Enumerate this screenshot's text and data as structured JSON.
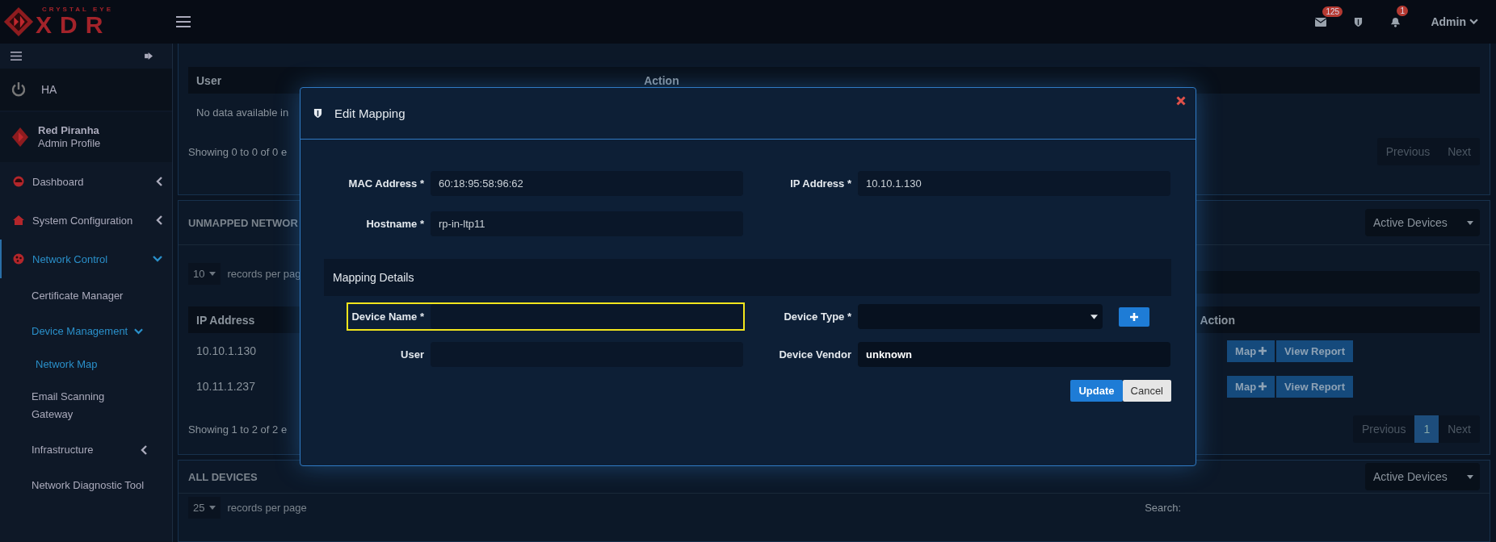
{
  "brand": {
    "tagline": "CRYSTAL EYE",
    "name": "XDR"
  },
  "topbar": {
    "icons": [
      {
        "kind": "mail",
        "badge": "125"
      },
      {
        "kind": "shield"
      },
      {
        "kind": "bell",
        "badge": "1"
      }
    ],
    "user": "Admin"
  },
  "sidebar": {
    "ha": "HA",
    "profile": {
      "name": "Red Piranha",
      "role": "Admin Profile"
    },
    "items": [
      {
        "label": "Dashboard",
        "kind": "gauge",
        "selected": false,
        "expanded": false
      },
      {
        "label": "System Configuration",
        "kind": "home",
        "selected": false,
        "expanded": false
      },
      {
        "label": "Network Control",
        "kind": "globe",
        "selected": true,
        "expanded": true,
        "children": [
          {
            "label": "Certificate Manager",
            "selected": false
          },
          {
            "label": "Device Management",
            "selected": true,
            "expanded": true,
            "children": [
              {
                "label": "Network Map",
                "selected": true
              }
            ]
          },
          {
            "label": "Email Scanning Gateway",
            "selected": false
          },
          {
            "label": "Infrastructure",
            "selected": false,
            "expanded": false
          },
          {
            "label": "Network Diagnostic Tool",
            "selected": false
          }
        ]
      }
    ]
  },
  "panels": [
    {
      "kind": "users",
      "columns": [
        "User",
        "Action"
      ],
      "empty": "No data available in",
      "footer": "Showing 0 to 0 of 0 e",
      "pagination": [
        {
          "label": "Previous",
          "selected": false
        },
        {
          "label": "Next",
          "selected": false
        }
      ]
    },
    {
      "kind": "table",
      "title": "UNMAPPED NETWOR",
      "filter": "Active Devices",
      "page_size": "10",
      "page_size_label": "records per pag",
      "columns": [
        "IP Address",
        "Action"
      ],
      "rows": [
        {
          "ip": "10.10.1.130",
          "actions": [
            {
              "label": "Map",
              "kind": "add"
            },
            {
              "label": "View Report",
              "kind": "plain"
            }
          ]
        },
        {
          "ip": "10.11.1.237",
          "actions": [
            {
              "label": "Map",
              "kind": "add"
            },
            {
              "label": "View Report",
              "kind": "plain"
            }
          ]
        }
      ],
      "footer": "Showing 1 to 2 of 2 e",
      "pagination": [
        {
          "label": "Previous",
          "selected": false
        },
        {
          "label": "1",
          "selected": true
        },
        {
          "label": "Next",
          "selected": false
        }
      ]
    },
    {
      "kind": "short",
      "title": "ALL DEVICES",
      "filter": "Active Devices",
      "page_size": "25",
      "page_size_label": "records per page",
      "search_label": "Search:"
    }
  ],
  "modal": {
    "title": "Edit Mapping",
    "fields": [
      {
        "label": "MAC Address *",
        "value": "60:18:95:58:96:62"
      },
      {
        "label": "IP Address *",
        "value": "10.10.1.130"
      },
      {
        "label": "Hostname *",
        "value": "rp-in-ltp11"
      }
    ],
    "section": "Mapping Details",
    "mapping_fields": [
      {
        "label": "Device Name *",
        "kind": "text",
        "focused": true
      },
      {
        "label": "Device Type *",
        "kind": "select",
        "focused": false
      },
      {
        "label": "User",
        "kind": "text",
        "focused": false
      },
      {
        "label": "Device Vendor",
        "kind": "text",
        "value": "unknown",
        "focused": false
      }
    ],
    "buttons": [
      {
        "label": "Update",
        "kind": "primary"
      },
      {
        "label": "Cancel",
        "kind": "secondary"
      }
    ]
  }
}
